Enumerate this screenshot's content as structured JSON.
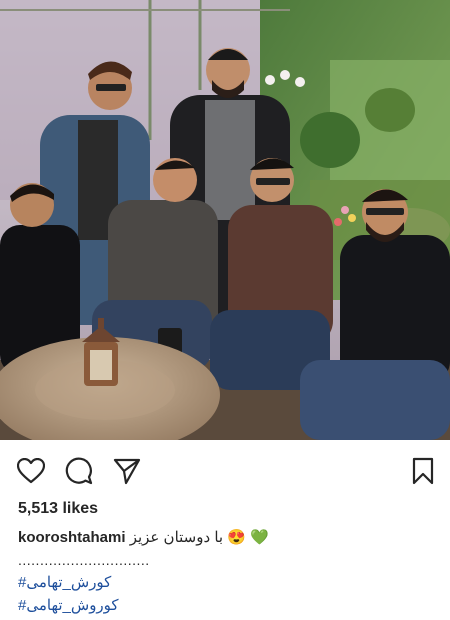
{
  "post": {
    "photo_alt": "group photo",
    "likes": "5,513 likes",
    "caption_user": "kooroshtahami",
    "caption_text": "با دوستان عزیز",
    "caption_emoji": "😍",
    "caption_heart": "💚",
    "dots": "..............................",
    "hashtags": [
      "#کورش_تهامی",
      "#کوروش_تهامی"
    ]
  },
  "icons": {
    "like": "heart-outline-icon",
    "comment": "comment-bubble-icon",
    "share": "paper-plane-icon",
    "save": "bookmark-icon"
  },
  "colors": {
    "text": "#262626",
    "hashtag": "#1e4f9c",
    "background": "#ffffff"
  }
}
